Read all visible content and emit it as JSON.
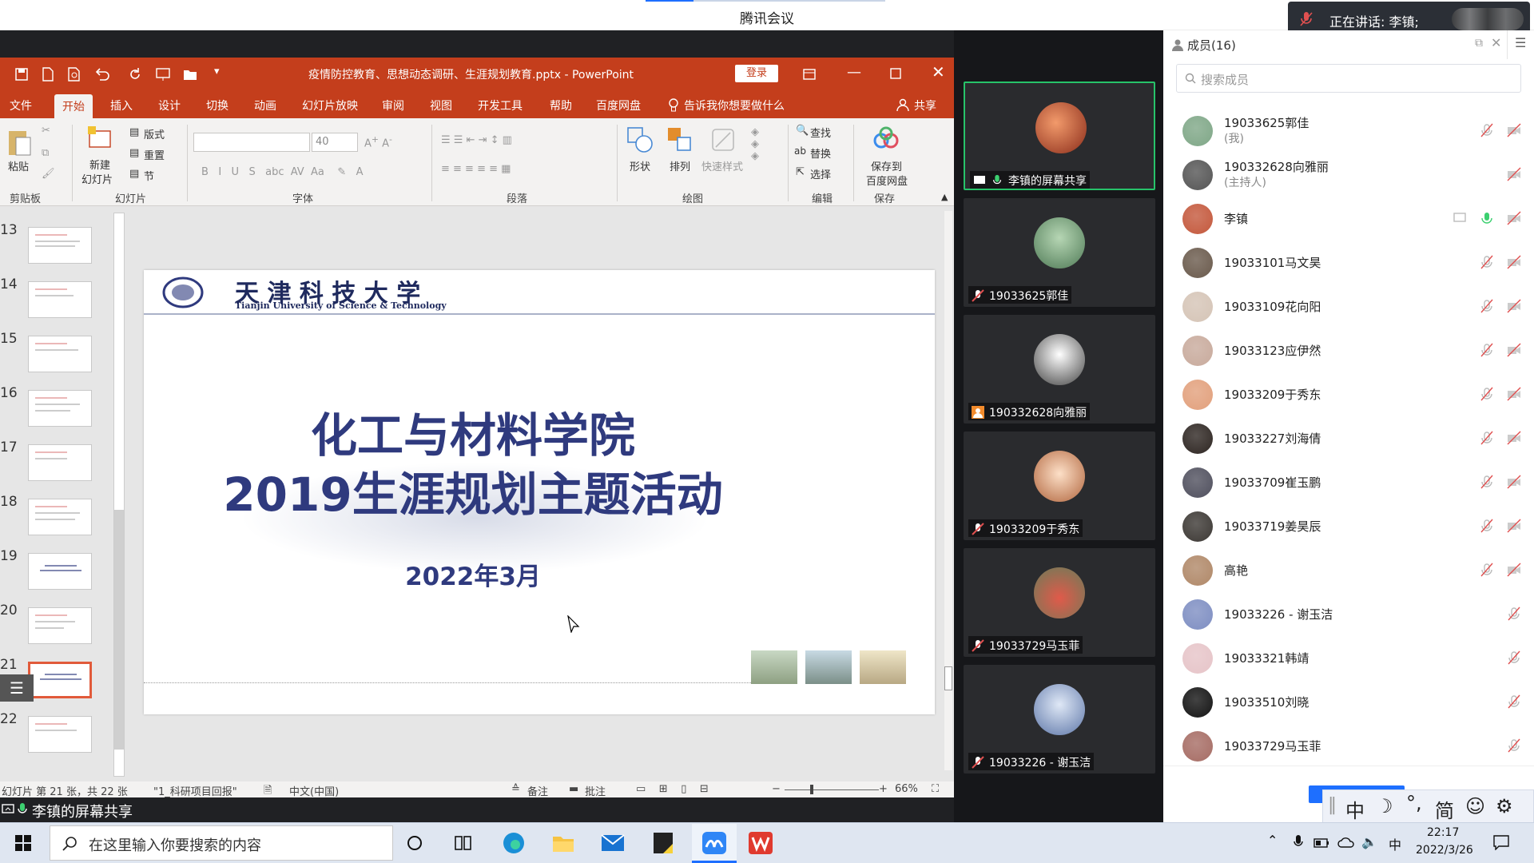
{
  "window": {
    "title": "腾讯会议"
  },
  "speaking": {
    "text": "正在讲话: 李镇;"
  },
  "ppt": {
    "filename": "疫情防控教育、思想动态调研、生涯规划教育.pptx  -  PowerPoint",
    "login": "登录",
    "tabs": [
      "文件",
      "开始",
      "插入",
      "设计",
      "切换",
      "动画",
      "幻灯片放映",
      "审阅",
      "视图",
      "开发工具",
      "帮助",
      "百度网盘"
    ],
    "tell_me": "告诉我你想要做什么",
    "share": "共享",
    "ribbon": {
      "paste": "粘贴",
      "new_slide_1": "新建",
      "new_slide_2": "幻灯片",
      "layout": "版式",
      "reset": "重置",
      "section": "节",
      "font_size": "40",
      "shape": "形状",
      "arrange": "排列",
      "quick_style": "快速样式",
      "find": "查找",
      "replace": "替换",
      "select": "选择",
      "save_to_1": "保存到",
      "save_to_2": "百度网盘",
      "groups": [
        "剪贴板",
        "幻灯片",
        "字体",
        "段落",
        "绘图",
        "编辑",
        "保存"
      ]
    },
    "slide_numbers": [
      "13",
      "14",
      "15",
      "16",
      "17",
      "18",
      "19",
      "20",
      "21",
      "22"
    ],
    "slide": {
      "school_cn": "天 津 科 技 大 学",
      "school_en": "Tianjin University of Science & Technology",
      "title1": "化工与材料学院",
      "title2": "2019生涯规划主题活动",
      "date": "2022年3月"
    },
    "status": {
      "slide_count": "幻灯片 第 21 张，共 22 张",
      "project": "\"1_科研项目回报\"",
      "lang": "中文(中国)",
      "notes": "备注",
      "comments": "批注",
      "zoom": "66%"
    },
    "share_label": "李镇的屏幕共享"
  },
  "videos": [
    {
      "name": "李镇的屏幕共享",
      "color": "#d9573a"
    },
    {
      "name": "19033625郭佳",
      "color": "#6d9a74"
    },
    {
      "name": "190332628向雅丽",
      "color": "#dddddd"
    },
    {
      "name": "19033209于秀东",
      "color": "#f3c7a3"
    },
    {
      "name": "19033729马玉菲",
      "color": "#c88c78"
    },
    {
      "name": "19033226 - 谢玉洁",
      "color": "#8aa8d6"
    }
  ],
  "members": {
    "title": "成员(16)",
    "search_placeholder": "搜索成员",
    "list": [
      {
        "name": "19033625郭佳",
        "role": "(我)",
        "color": "#7fa787"
      },
      {
        "name": "190332628向雅丽",
        "role": "(主持人)",
        "color": "#555555"
      },
      {
        "name": "李镇",
        "role": "",
        "color": "#c4583c"
      },
      {
        "name": "19033101马文昊",
        "role": "",
        "color": "#6a5a4c"
      },
      {
        "name": "19033109花向阳",
        "role": "",
        "color": "#d5c4b6"
      },
      {
        "name": "19033123应伊然",
        "role": "",
        "color": "#c8aa9c"
      },
      {
        "name": "19033209于秀东",
        "role": "",
        "color": "#e2a07c"
      },
      {
        "name": "19033227刘海倩",
        "role": "",
        "color": "#2e2622"
      },
      {
        "name": "19033709崔玉鹏",
        "role": "",
        "color": "#50505e"
      },
      {
        "name": "19033719姜昊辰",
        "role": "",
        "color": "#3c3834"
      },
      {
        "name": "高艳",
        "role": "",
        "color": "#b08868"
      },
      {
        "name": "19033226 - 谢玉洁",
        "role": "",
        "color": "#7e8ec2"
      },
      {
        "name": "19033321韩靖",
        "role": "",
        "color": "#e6c4c8"
      },
      {
        "name": "19033510刘晓",
        "role": "",
        "color": "#141414"
      },
      {
        "name": "19033729马玉菲",
        "role": "",
        "color": "#a66c64"
      }
    ]
  },
  "ime": {
    "chars": [
      "中",
      "简"
    ]
  },
  "taskbar": {
    "search_placeholder": "在这里输入你要搜索的内容",
    "ime": "中",
    "time": "22:17",
    "date": "2022/3/26"
  }
}
